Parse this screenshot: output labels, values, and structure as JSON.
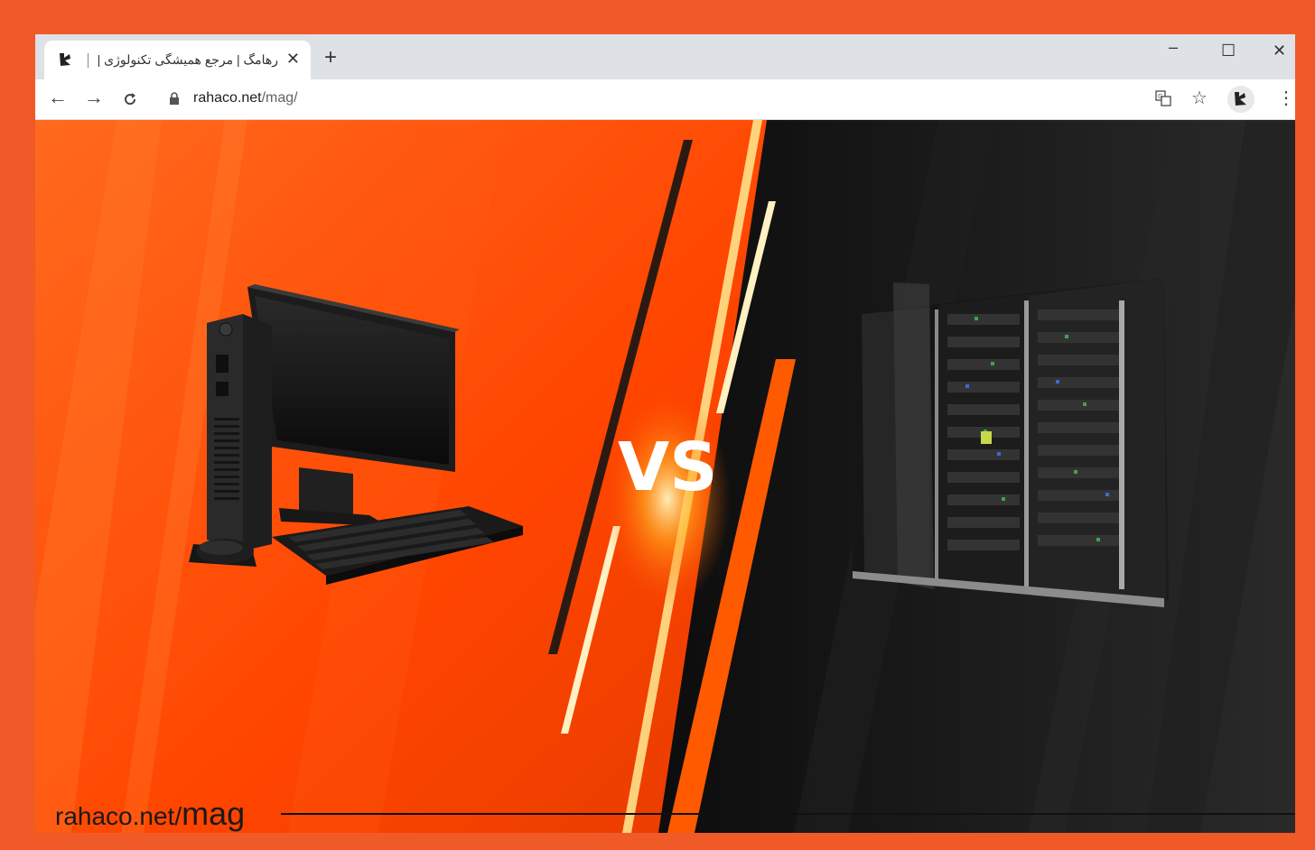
{
  "browser": {
    "tab_title": "رهامگ | مرجع همیشگی تکنولوژی |",
    "tab_favicon": "rahaco-logo-icon",
    "url_domain": "rahaco.net",
    "url_path": "/mag/",
    "window_controls": [
      "minimize-icon",
      "maximize-icon",
      "close-icon"
    ],
    "toolbar_icons": [
      "translate-icon",
      "bookmark-star-icon",
      "extension-icon",
      "menu-icon"
    ]
  },
  "banner": {
    "vs_text": "VS",
    "left_item": "desktop-computer",
    "right_item": "server-rack",
    "brand_domain": "rahaco.net/",
    "brand_path": "mag",
    "colors": {
      "orange": "#f05a28",
      "deep_orange": "#ff4a00",
      "dark": "#0d0d0d"
    }
  }
}
